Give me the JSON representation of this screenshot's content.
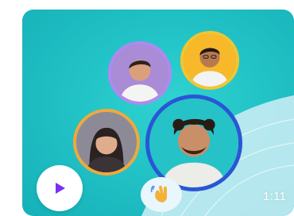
{
  "video_card": {
    "duration": "1:11",
    "colors": {
      "background": "#1fbfc4",
      "play_button": "#ffffff",
      "play_icon": "#7b2ff7",
      "ring_purple": "#b487f0",
      "ring_yellow": "#f4c430",
      "ring_orange": "#f2a83a",
      "ring_blue": "#2a56d6"
    },
    "icons": {
      "play": "play-icon",
      "reaction": "waving-hand-icon"
    }
  }
}
